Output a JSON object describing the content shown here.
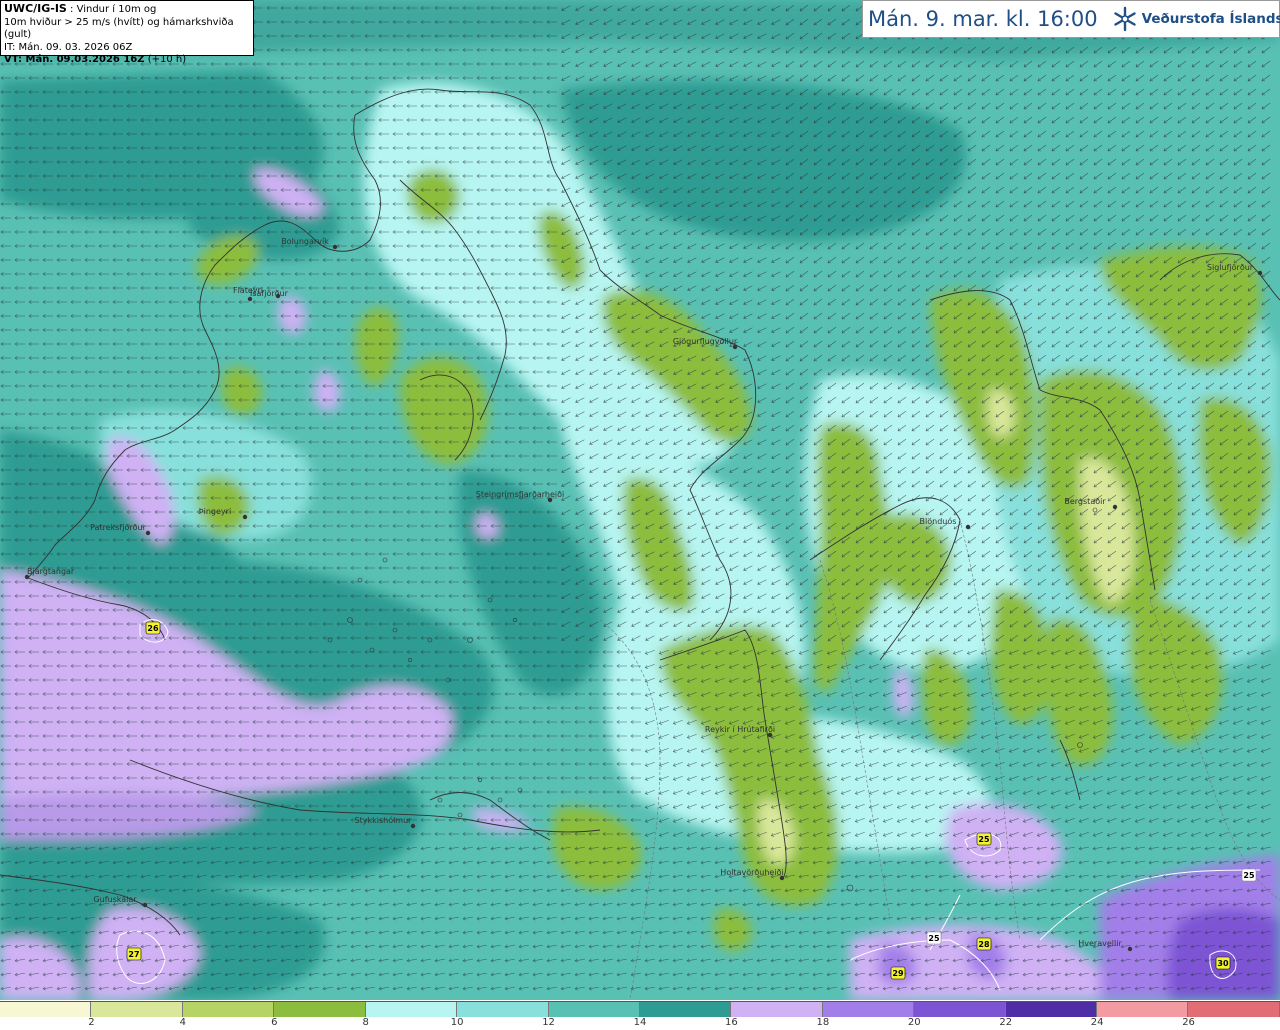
{
  "info": {
    "line1_bold": "UWC/IG-IS",
    "line1_rest": " : Vindur í 10m og",
    "line2": "10m hviður > 25 m/s (hvítt) og hámarkshviða (gult)",
    "line3": "IT: Mán. 09. 03. 2026 06Z",
    "line4_bold": "VT: Mán. 09.03.2026 16Z",
    "line4_rest": " (+10 h)"
  },
  "header": {
    "title": "Mán. 9. mar. kl. 16:00",
    "brand": "Veðurstofa Íslands",
    "icon": "snowflake-logo-icon"
  },
  "colors": {
    "land_outline": "#333333",
    "arrow": "#23393a",
    "bands": [
      "#f7f7d3",
      "#d9e79a",
      "#b6d465",
      "#8cbd3d",
      "#b7f5f2",
      "#88e0dc",
      "#59c0b4",
      "#2e9c93",
      "#cfb1f4",
      "#a27fe8",
      "#7d54d4",
      "#4e2da5",
      "#f39aa2",
      "#e16e74"
    ]
  },
  "legend": {
    "ticks": [
      "2",
      "4",
      "6",
      "8",
      "10",
      "12",
      "14",
      "16",
      "18",
      "20",
      "22",
      "24",
      "26"
    ]
  },
  "places": [
    {
      "name": "Bolungarvík"
    },
    {
      "name": "Ísafjörður"
    },
    {
      "name": "Flateyri"
    },
    {
      "name": "Þingeyri"
    },
    {
      "name": "Patreksfjörður"
    },
    {
      "name": "Bjargtangar"
    },
    {
      "name": "Gjögurflugvöllur"
    },
    {
      "name": "Steingrímsfjarðarheiði"
    },
    {
      "name": "Blönduós"
    },
    {
      "name": "Bergstaðir"
    },
    {
      "name": "Siglufjörður"
    },
    {
      "name": "Reykir í Hrútafirði"
    },
    {
      "name": "Holtavörðuheiði"
    },
    {
      "name": "Stykkishólmur"
    },
    {
      "name": "Gufuskálar"
    },
    {
      "name": "Hveravellir"
    }
  ],
  "gusts": [
    {
      "value": "26"
    },
    {
      "value": "27"
    },
    {
      "value": "25"
    },
    {
      "value": "28"
    },
    {
      "value": "29"
    },
    {
      "value": "30"
    },
    {
      "value": "25"
    },
    {
      "value": "25"
    }
  ]
}
